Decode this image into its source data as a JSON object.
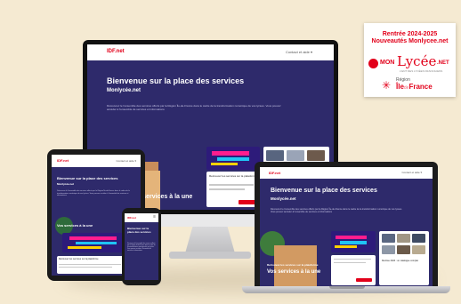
{
  "sign": {
    "line1": "Rentrée 2024-2025",
    "line2": "Nouveautés Monlycee.net",
    "mon": "MON",
    "lycee": "Lycée",
    "net": ".NET",
    "tagline": "L'ENT DES LYCÉES FRANCILIENS",
    "region_label": "Région",
    "region_name_a": "Île",
    "region_name_b": "de",
    "region_name_c": "France"
  },
  "site": {
    "logo": "IDF.net",
    "nav_right": "Contact et aide ▾",
    "hero_title": "Bienvenue sur la place des services",
    "hero_subtitle": "Monlycée.net",
    "hero_text": "Découvrez le l'ensemble des services offerts par la Région Île-de-France dans le cadre de la transformation numérique de vos lycées. Vous pouvez accéder à l'ensemble de services et informations",
    "section_title": "Vos services à la une",
    "news_caption": "Retrouvez les services sur la plateforme",
    "news_caption_b": "Rentrée 2024 : un catalogue complet"
  },
  "colors": {
    "brand_red": "#e2001a",
    "hero_navy": "#2e2a6b",
    "background": "#f5ead2"
  }
}
